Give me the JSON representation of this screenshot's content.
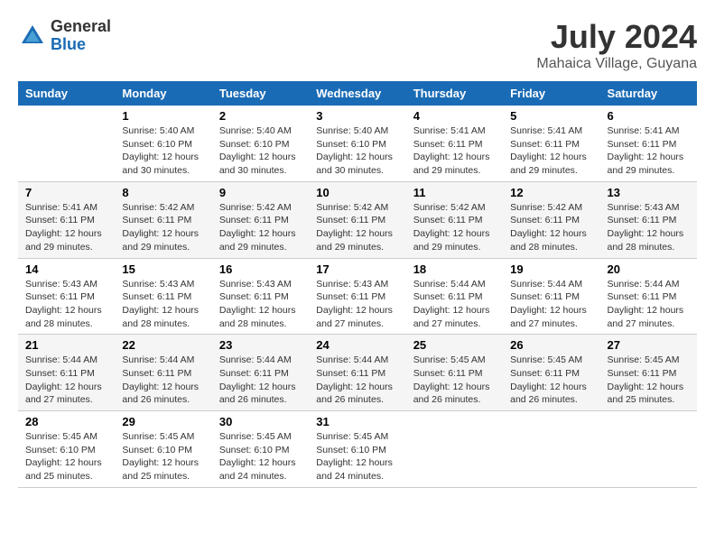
{
  "header": {
    "logo": {
      "general": "General",
      "blue": "Blue"
    },
    "title": "July 2024",
    "subtitle": "Mahaica Village, Guyana"
  },
  "columns": [
    "Sunday",
    "Monday",
    "Tuesday",
    "Wednesday",
    "Thursday",
    "Friday",
    "Saturday"
  ],
  "weeks": [
    [
      {
        "day": "",
        "info": ""
      },
      {
        "day": "1",
        "info": "Sunrise: 5:40 AM\nSunset: 6:10 PM\nDaylight: 12 hours\nand 30 minutes."
      },
      {
        "day": "2",
        "info": "Sunrise: 5:40 AM\nSunset: 6:10 PM\nDaylight: 12 hours\nand 30 minutes."
      },
      {
        "day": "3",
        "info": "Sunrise: 5:40 AM\nSunset: 6:10 PM\nDaylight: 12 hours\nand 30 minutes."
      },
      {
        "day": "4",
        "info": "Sunrise: 5:41 AM\nSunset: 6:11 PM\nDaylight: 12 hours\nand 29 minutes."
      },
      {
        "day": "5",
        "info": "Sunrise: 5:41 AM\nSunset: 6:11 PM\nDaylight: 12 hours\nand 29 minutes."
      },
      {
        "day": "6",
        "info": "Sunrise: 5:41 AM\nSunset: 6:11 PM\nDaylight: 12 hours\nand 29 minutes."
      }
    ],
    [
      {
        "day": "7",
        "info": "Sunrise: 5:41 AM\nSunset: 6:11 PM\nDaylight: 12 hours\nand 29 minutes."
      },
      {
        "day": "8",
        "info": "Sunrise: 5:42 AM\nSunset: 6:11 PM\nDaylight: 12 hours\nand 29 minutes."
      },
      {
        "day": "9",
        "info": "Sunrise: 5:42 AM\nSunset: 6:11 PM\nDaylight: 12 hours\nand 29 minutes."
      },
      {
        "day": "10",
        "info": "Sunrise: 5:42 AM\nSunset: 6:11 PM\nDaylight: 12 hours\nand 29 minutes."
      },
      {
        "day": "11",
        "info": "Sunrise: 5:42 AM\nSunset: 6:11 PM\nDaylight: 12 hours\nand 29 minutes."
      },
      {
        "day": "12",
        "info": "Sunrise: 5:42 AM\nSunset: 6:11 PM\nDaylight: 12 hours\nand 28 minutes."
      },
      {
        "day": "13",
        "info": "Sunrise: 5:43 AM\nSunset: 6:11 PM\nDaylight: 12 hours\nand 28 minutes."
      }
    ],
    [
      {
        "day": "14",
        "info": "Sunrise: 5:43 AM\nSunset: 6:11 PM\nDaylight: 12 hours\nand 28 minutes."
      },
      {
        "day": "15",
        "info": "Sunrise: 5:43 AM\nSunset: 6:11 PM\nDaylight: 12 hours\nand 28 minutes."
      },
      {
        "day": "16",
        "info": "Sunrise: 5:43 AM\nSunset: 6:11 PM\nDaylight: 12 hours\nand 28 minutes."
      },
      {
        "day": "17",
        "info": "Sunrise: 5:43 AM\nSunset: 6:11 PM\nDaylight: 12 hours\nand 27 minutes."
      },
      {
        "day": "18",
        "info": "Sunrise: 5:44 AM\nSunset: 6:11 PM\nDaylight: 12 hours\nand 27 minutes."
      },
      {
        "day": "19",
        "info": "Sunrise: 5:44 AM\nSunset: 6:11 PM\nDaylight: 12 hours\nand 27 minutes."
      },
      {
        "day": "20",
        "info": "Sunrise: 5:44 AM\nSunset: 6:11 PM\nDaylight: 12 hours\nand 27 minutes."
      }
    ],
    [
      {
        "day": "21",
        "info": "Sunrise: 5:44 AM\nSunset: 6:11 PM\nDaylight: 12 hours\nand 27 minutes."
      },
      {
        "day": "22",
        "info": "Sunrise: 5:44 AM\nSunset: 6:11 PM\nDaylight: 12 hours\nand 26 minutes."
      },
      {
        "day": "23",
        "info": "Sunrise: 5:44 AM\nSunset: 6:11 PM\nDaylight: 12 hours\nand 26 minutes."
      },
      {
        "day": "24",
        "info": "Sunrise: 5:44 AM\nSunset: 6:11 PM\nDaylight: 12 hours\nand 26 minutes."
      },
      {
        "day": "25",
        "info": "Sunrise: 5:45 AM\nSunset: 6:11 PM\nDaylight: 12 hours\nand 26 minutes."
      },
      {
        "day": "26",
        "info": "Sunrise: 5:45 AM\nSunset: 6:11 PM\nDaylight: 12 hours\nand 26 minutes."
      },
      {
        "day": "27",
        "info": "Sunrise: 5:45 AM\nSunset: 6:11 PM\nDaylight: 12 hours\nand 25 minutes."
      }
    ],
    [
      {
        "day": "28",
        "info": "Sunrise: 5:45 AM\nSunset: 6:10 PM\nDaylight: 12 hours\nand 25 minutes."
      },
      {
        "day": "29",
        "info": "Sunrise: 5:45 AM\nSunset: 6:10 PM\nDaylight: 12 hours\nand 25 minutes."
      },
      {
        "day": "30",
        "info": "Sunrise: 5:45 AM\nSunset: 6:10 PM\nDaylight: 12 hours\nand 24 minutes."
      },
      {
        "day": "31",
        "info": "Sunrise: 5:45 AM\nSunset: 6:10 PM\nDaylight: 12 hours\nand 24 minutes."
      },
      {
        "day": "",
        "info": ""
      },
      {
        "day": "",
        "info": ""
      },
      {
        "day": "",
        "info": ""
      }
    ]
  ]
}
